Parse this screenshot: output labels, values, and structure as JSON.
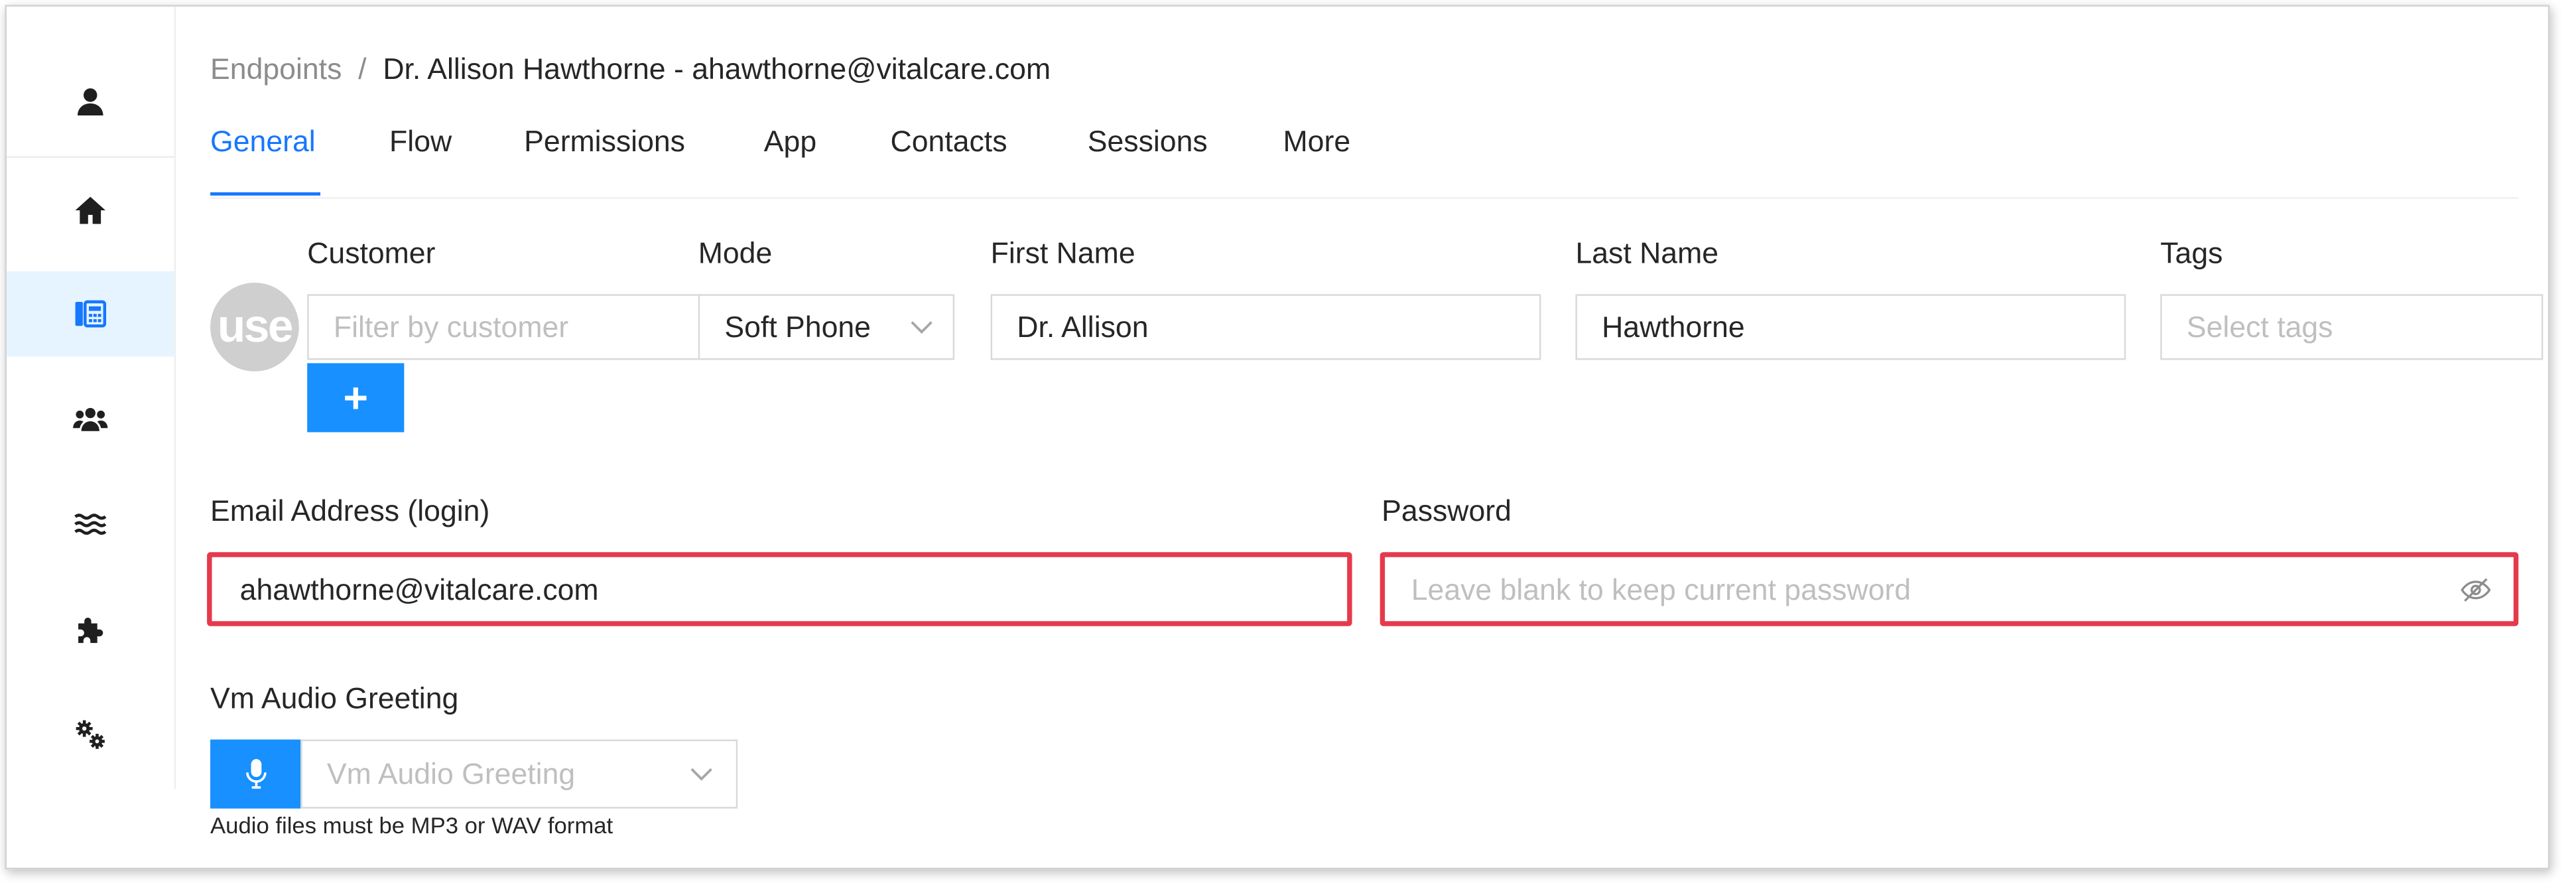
{
  "sidebar": {
    "items": [
      {
        "icon": "user-icon"
      },
      {
        "icon": "home-icon"
      },
      {
        "icon": "endpoints-icon",
        "active": true
      },
      {
        "icon": "users-group-icon"
      },
      {
        "icon": "flow-waves-icon"
      },
      {
        "icon": "puzzle-icon"
      },
      {
        "icon": "settings-gears-icon"
      }
    ]
  },
  "breadcrumb": {
    "parent": "Endpoints",
    "separator": "/",
    "current": "Dr. Allison Hawthorne - ahawthorne@vitalcare.com"
  },
  "tabs": [
    {
      "label": "General",
      "active": true
    },
    {
      "label": "Flow"
    },
    {
      "label": "Permissions"
    },
    {
      "label": "App"
    },
    {
      "label": "Contacts"
    },
    {
      "label": "Sessions"
    },
    {
      "label": "More"
    }
  ],
  "form": {
    "avatar_text": "use",
    "customer": {
      "label": "Customer",
      "placeholder": "Filter by customer",
      "add_label": "+"
    },
    "mode": {
      "label": "Mode",
      "value": "Soft Phone"
    },
    "first_name": {
      "label": "First Name",
      "value": "Dr. Allison"
    },
    "last_name": {
      "label": "Last Name",
      "value": "Hawthorne"
    },
    "tags": {
      "label": "Tags",
      "placeholder": "Select tags"
    },
    "email": {
      "label": "Email Address (login)",
      "value": "ahawthorne@vitalcare.com"
    },
    "password": {
      "label": "Password",
      "placeholder": "Leave blank to keep current password"
    },
    "vm_greeting": {
      "label": "Vm Audio Greeting",
      "placeholder": "Vm Audio Greeting",
      "hint": "Audio files must be MP3 or WAV format"
    }
  },
  "colors": {
    "accent": "#1677ff",
    "highlight": "#e53a4b"
  }
}
